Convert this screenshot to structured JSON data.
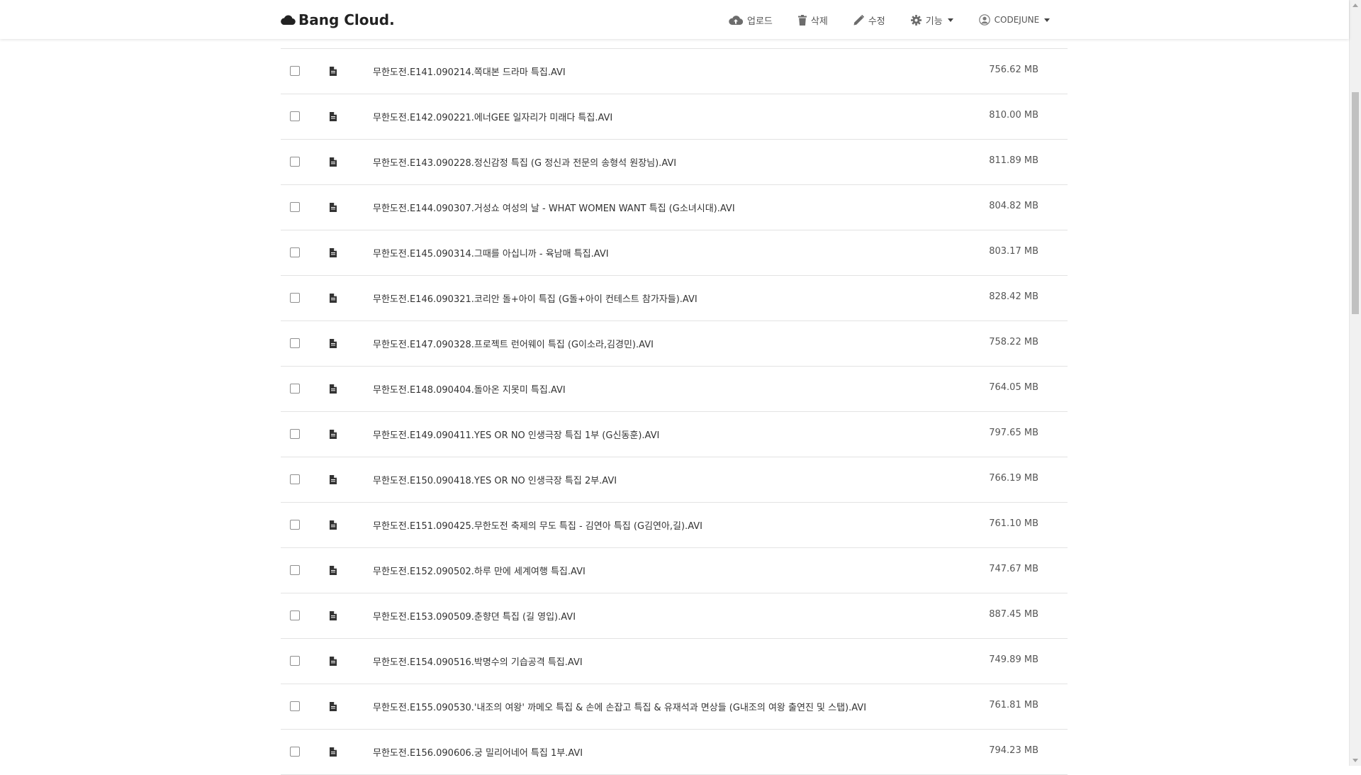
{
  "brand": {
    "name": "Bang Cloud."
  },
  "nav": {
    "upload_label": "업로드",
    "delete_label": "삭제",
    "edit_label": "수정",
    "features_label": "기능",
    "user_label": "CODEJUNE"
  },
  "files": [
    {
      "name": "무한도전.E141.090214.쪽대본 드라마 특집.AVI",
      "size": "756.62 MB"
    },
    {
      "name": "무한도전.E142.090221.에너GEE 일자리가 미래다 특집.AVI",
      "size": "810.00 MB"
    },
    {
      "name": "무한도전.E143.090228.정신감정 특집 (G 정신과 전문의 송형석 원장님).AVI",
      "size": "811.89 MB"
    },
    {
      "name": "무한도전.E144.090307.거성쇼 여성의 날 - WHAT WOMEN WANT 특집 (G소녀시대).AVI",
      "size": "804.82 MB"
    },
    {
      "name": "무한도전.E145.090314.그때를 아십니까 - 육남매 특집.AVI",
      "size": "803.17 MB"
    },
    {
      "name": "무한도전.E146.090321.코리안 돌+아이 특집 (G돌+아이 컨테스트 참가자들).AVI",
      "size": "828.42 MB"
    },
    {
      "name": "무한도전.E147.090328.프로젝트 런어웨이 특집 (G이소라,김경민).AVI",
      "size": "758.22 MB"
    },
    {
      "name": "무한도전.E148.090404.돌아온 지못미 특집.AVI",
      "size": "764.05 MB"
    },
    {
      "name": "무한도전.E149.090411.YES OR NO 인생극장 특집 1부 (G신동훈).AVI",
      "size": "797.65 MB"
    },
    {
      "name": "무한도전.E150.090418.YES OR NO 인생극장 특집 2부.AVI",
      "size": "766.19 MB"
    },
    {
      "name": "무한도전.E151.090425.무한도전 축제의 무도 특집 - 김연아 특집 (G김연아,길).AVI",
      "size": "761.10 MB"
    },
    {
      "name": "무한도전.E152.090502.하루 만에 세계여행 특집.AVI",
      "size": "747.67 MB"
    },
    {
      "name": "무한도전.E153.090509.춘향뎐 특집 (길 영입).AVI",
      "size": "887.45 MB"
    },
    {
      "name": "무한도전.E154.090516.박명수의 기습공격 특집.AVI",
      "size": "749.89 MB"
    },
    {
      "name": "무한도전.E155.090530.'내조의 여왕' 까메오 특집 & 손에 손잡고 특집 & 유재석과 면상들 (G내조의 여왕 출연진 및 스탭).AVI",
      "size": "761.81 MB"
    },
    {
      "name": "무한도전.E156.090606.궁 밀리어네어 특집 1부.AVI",
      "size": "794.23 MB"
    }
  ]
}
